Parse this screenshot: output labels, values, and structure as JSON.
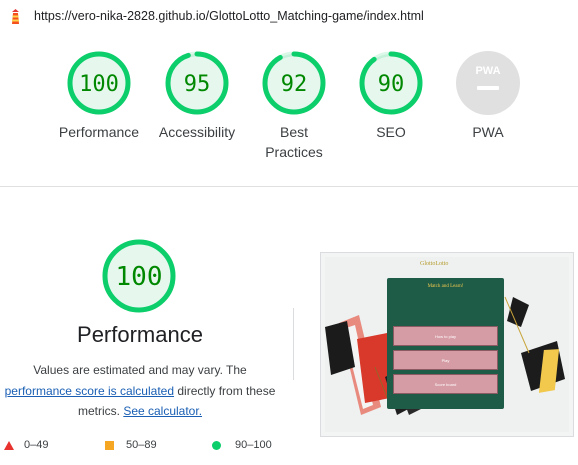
{
  "url_bar": {
    "url": "https://vero-nika-2828.github.io/GlottoLotto_Matching-game/index.html",
    "icon": "lighthouse-icon"
  },
  "gauges": [
    {
      "score": "100",
      "label": "Performance",
      "percent": 100
    },
    {
      "score": "95",
      "label": "Accessibility",
      "percent": 95
    },
    {
      "score": "92",
      "label_line1": "Best",
      "label_line2": "Practices",
      "percent": 92
    },
    {
      "score": "90",
      "label": "SEO",
      "percent": 90
    },
    {
      "badge": "PWA",
      "label": "PWA"
    }
  ],
  "performance": {
    "score": "100",
    "title": "Performance",
    "desc_part1": "Values are estimated and may vary. The",
    "link1": "performance score is calculated",
    "desc_part2": "directly from these",
    "desc_part3": "metrics.",
    "link2": "See calculator."
  },
  "legend": [
    {
      "range": "0–49",
      "shape": "triangle",
      "color": "#e8322e"
    },
    {
      "range": "50–89",
      "shape": "square",
      "color": "#f5a623"
    },
    {
      "range": "90–100",
      "shape": "circle",
      "color": "#0cce6b"
    }
  ],
  "screenshot": {
    "logo": "GlottoLotto",
    "card_title": "Match and Learn!",
    "buttons": [
      "How to play",
      "Play",
      "Score board"
    ]
  },
  "colors": {
    "pass_green": "#0cce6b",
    "pass_green_text": "#008800",
    "pass_fill": "#e6f7ee",
    "pwa_gray": "#e0e0e0"
  }
}
